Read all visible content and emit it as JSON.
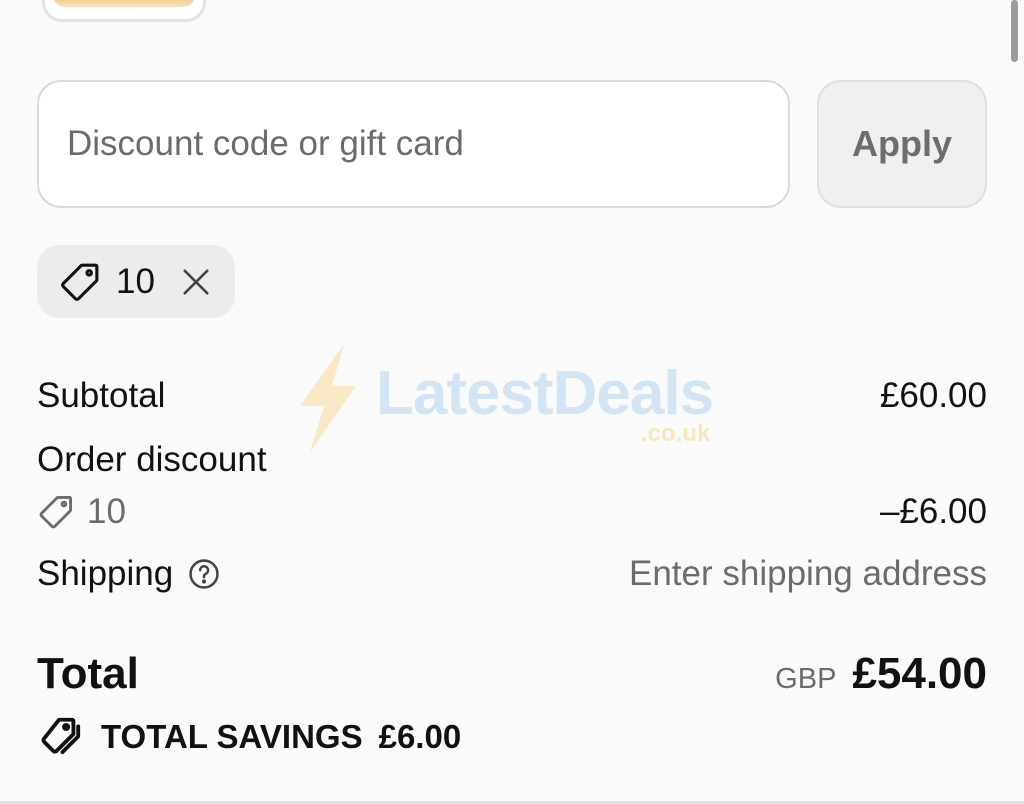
{
  "discount": {
    "placeholder": "Discount code or gift card",
    "value": "",
    "apply_label": "Apply",
    "applied_code": "10"
  },
  "summary": {
    "subtotal_label": "Subtotal",
    "subtotal_value": "£60.00",
    "order_discount_label": "Order discount",
    "discount_code": "10",
    "discount_value": "–£6.00",
    "shipping_label": "Shipping",
    "shipping_value": "Enter shipping address"
  },
  "total": {
    "label": "Total",
    "currency": "GBP",
    "amount": "£54.00"
  },
  "savings": {
    "label": "TOTAL SAVINGS",
    "amount": "£6.00"
  },
  "watermark": {
    "text": "LatestDeals",
    "subtext": ".co.uk"
  },
  "icons": {
    "tag": "tag-icon",
    "close": "close-icon",
    "help": "help-circle-icon",
    "tags": "tags-icon",
    "bolt": "lightning-bolt-icon"
  },
  "colors": {
    "background": "#fafafa",
    "muted_text": "#6b6b6b",
    "chip_bg": "#ececec",
    "watermark_blue": "#6eafe6",
    "watermark_yellow": "#f5b93c"
  }
}
